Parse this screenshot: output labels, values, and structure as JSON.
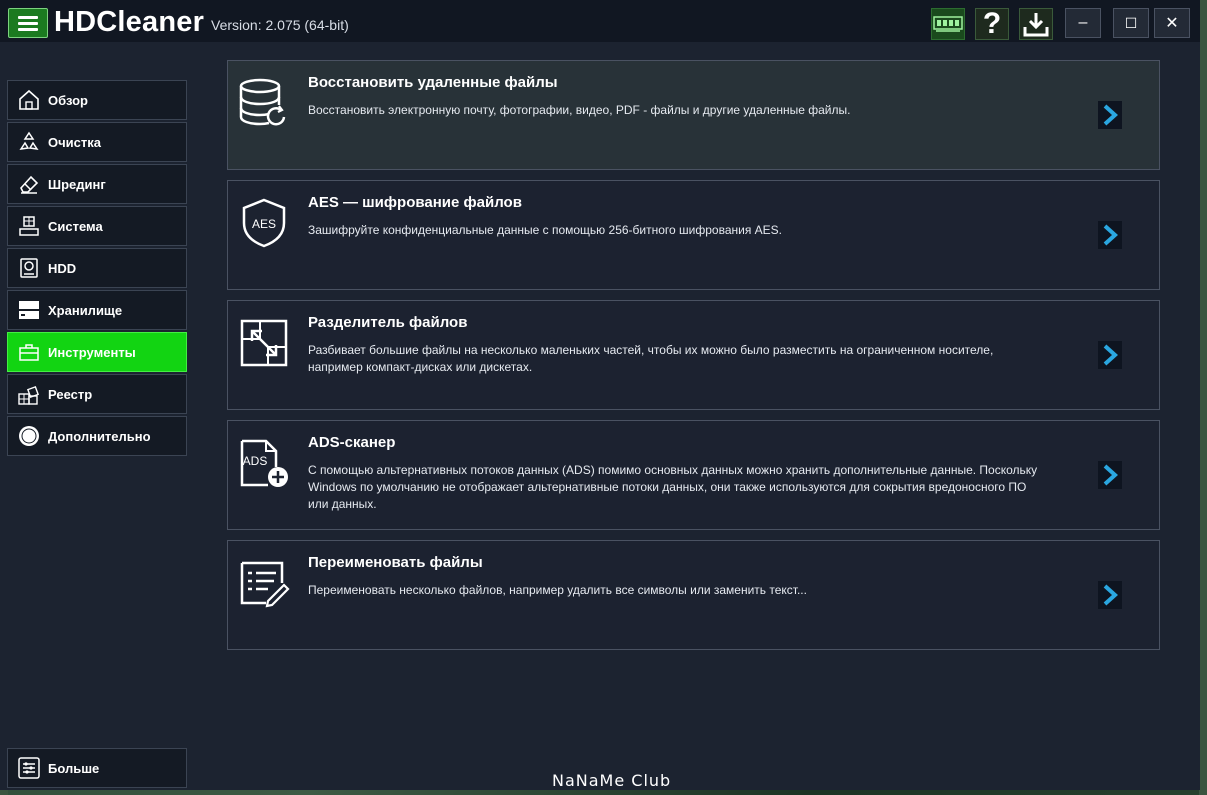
{
  "app": {
    "title": "HDCleaner",
    "version": "Version: 2.075 (64-bit)"
  },
  "titlebar": {
    "help_label": "?",
    "minimize_label": "–",
    "maximize_label": "☐",
    "close_label": "✕"
  },
  "sidebar": {
    "items": [
      {
        "label": "Обзор",
        "icon": "home-icon"
      },
      {
        "label": "Очистка",
        "icon": "recycle-icon"
      },
      {
        "label": "Шрединг",
        "icon": "eraser-icon"
      },
      {
        "label": "Система",
        "icon": "system-icon"
      },
      {
        "label": "HDD",
        "icon": "hdd-icon"
      },
      {
        "label": "Хранилище",
        "icon": "storage-icon"
      },
      {
        "label": "Инструменты",
        "icon": "toolbox-icon",
        "active": true
      },
      {
        "label": "Реестр",
        "icon": "registry-icon"
      },
      {
        "label": "Дополнительно",
        "icon": "extra-icon"
      }
    ],
    "more_label": "Больше"
  },
  "cards": [
    {
      "title": "Восстановить удаленные файлы",
      "desc": "Восстановить электронную почту, фотографии, видео, PDF - файлы и другие удаленные файлы.",
      "icon": "database-restore-icon"
    },
    {
      "title": "AES — шифрование файлов",
      "desc": "Зашифруйте конфиденциальные данные с помощью 256-битного шифрования AES.",
      "icon": "aes-shield-icon",
      "badge": "AES"
    },
    {
      "title": "Разделитель файлов",
      "desc": "Разбивает большие файлы на несколько маленьких частей, чтобы их можно было разместить на ограниченном носителе, например компакт-дисках или дискетах.",
      "icon": "file-split-icon"
    },
    {
      "title": "ADS-сканер",
      "desc": " С помощью альтернативных потоков данных (ADS) помимо основных данных можно хранить дополнительные данные. Поскольку Windows по умолчанию не отображает альтернативные потоки данных, они также используются для сокрытия вредоносного ПО или данных.",
      "icon": "ads-file-icon",
      "badge": "ADS"
    },
    {
      "title": "Переименовать файлы",
      "desc": "Переименовать несколько файлов, например удалить все символы или заменить текст...",
      "icon": "rename-list-icon"
    }
  ],
  "watermark": "NaNaMe Club",
  "colors": {
    "accent": "#12d412",
    "arrow": "#2aa6e0",
    "background": "#1c2330"
  }
}
